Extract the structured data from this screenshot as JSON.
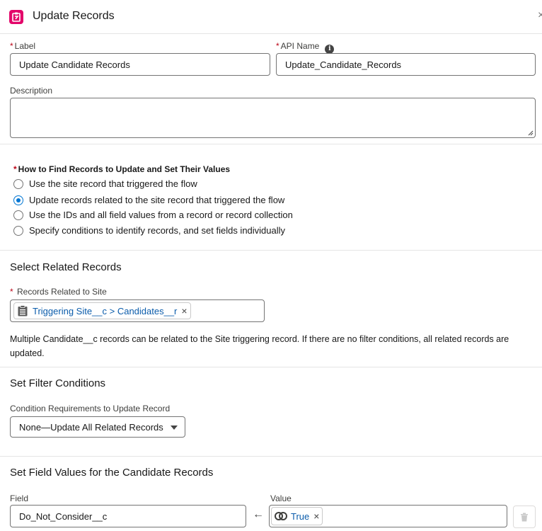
{
  "header": {
    "title": "Update Records",
    "close_glyph": "×",
    "icon": "update-records-icon",
    "icon_color": "#e3066a"
  },
  "label_field": {
    "label": "Label",
    "required_mark": "*",
    "value": "Update Candidate Records"
  },
  "api_name_field": {
    "label": "API Name",
    "required_mark": "*",
    "value": "Update_Candidate_Records",
    "info_glyph": "i"
  },
  "description_field": {
    "label": "Description",
    "value": ""
  },
  "find_records": {
    "heading": "How to Find Records to Update and Set Their Values",
    "required_mark": "*",
    "options": [
      {
        "label": "Use the site record that triggered the flow",
        "selected": false
      },
      {
        "label": "Update records related to the site record that triggered the flow",
        "selected": true
      },
      {
        "label": "Use the IDs and all field values from a record or record collection",
        "selected": false
      },
      {
        "label": "Specify conditions to identify records, and set fields individually",
        "selected": false
      }
    ]
  },
  "related_records": {
    "title": "Select Related Records",
    "field_label": "Records Related to Site",
    "required_mark": "*",
    "pill_text": "Triggering Site__c > Candidates__r",
    "pill_remove": "×",
    "help_text": "Multiple Candidate__c records can be related to the Site triggering record. If there are no filter conditions, all related records are updated."
  },
  "filter": {
    "title": "Set Filter Conditions",
    "label": "Condition Requirements to Update Record",
    "selected": "None—Update All Related Records"
  },
  "field_values": {
    "title": "Set Field Values for the Candidate Records",
    "field_col_label": "Field",
    "value_col_label": "Value",
    "field_value": "Do_Not_Consider__c",
    "arrow_glyph": "←",
    "value_pill": "True",
    "value_pill_remove": "×"
  },
  "colors": {
    "accent": "#0176d3",
    "link": "#0b5cab",
    "required": "#ba0517",
    "border": "#747474"
  }
}
